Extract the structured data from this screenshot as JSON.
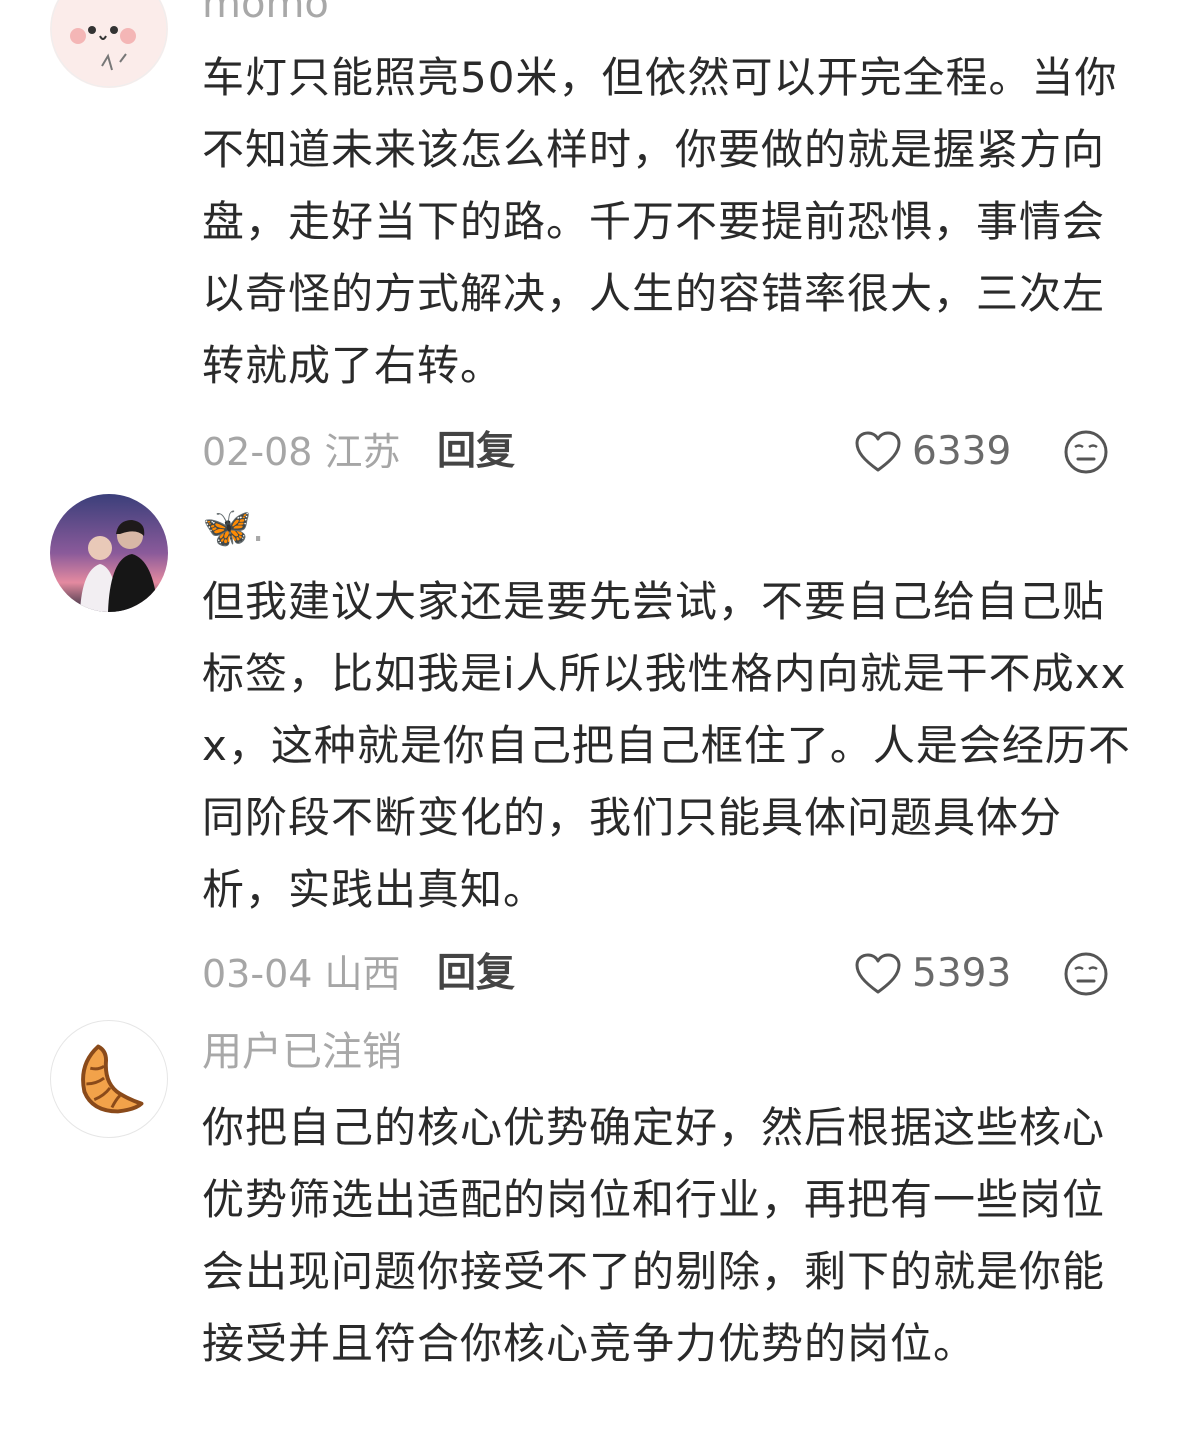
{
  "comments": [
    {
      "author": "momo",
      "text": "车灯只能照亮50米，但依然可以开完全程。当你不知道未来该怎么样时，你要做的就是握紧方向盘，走好当下的路。千万不要提前恐惧，事情会以奇怪的方式解决，人生的容错率很大，三次左转就成了右转。",
      "date_location": "02-08 江苏",
      "reply_label": "回复",
      "likes": "6339"
    },
    {
      "author": "🦋.",
      "text": "但我建议大家还是要先尝试，不要自己给自己贴标签，比如我是i人所以我性格内向就是干不成xxx，这种就是你自己把自己框住了。人是会经历不同阶段不断变化的，我们只能具体问题具体分析，实践出真知。",
      "date_location": "03-04 山西",
      "reply_label": "回复",
      "likes": "5393"
    },
    {
      "author": "用户已注销",
      "text": "你把自己的核心优势确定好，然后根据这些核心优势筛选出适配的岗位和行业，再把有一些岗位会出现问题你接受不了的剔除，剩下的就是你能接受并且符合你核心竞争力优势的岗位。"
    }
  ],
  "icons": {
    "like": "heart-outline-icon",
    "dislike": "neutral-face-icon"
  },
  "colors": {
    "text": "#2a2a2a",
    "meta": "#a6a6a6",
    "reply": "#444444",
    "icon": "#555555"
  }
}
